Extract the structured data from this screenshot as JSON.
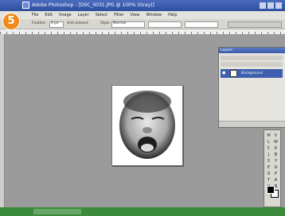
{
  "titlebar": {
    "title": "Adobe Photoshop - [DSC_0031.JPG @ 100% (Gray)]"
  },
  "badge": {
    "number": "5"
  },
  "menubar": {
    "items": [
      "File",
      "Edit",
      "Image",
      "Layer",
      "Select",
      "Filter",
      "View",
      "Window",
      "Help"
    ]
  },
  "optionsbar": {
    "feather_label": "Feather:",
    "feather_value": "0 px",
    "antialias_label": "Anti-aliased",
    "style_label": "Style:",
    "style_value": "Normal"
  },
  "layers_panel": {
    "tab_label": "Layers",
    "layer_name": "Background"
  },
  "toolbox": {
    "tools": [
      "M",
      "V",
      "L",
      "W",
      "C",
      "K",
      "J",
      "B",
      "S",
      "Y",
      "E",
      "G",
      "O",
      "P",
      "T",
      "A",
      "U",
      "N",
      "H",
      "Z"
    ]
  },
  "colors": {
    "badge": "#f08a1c",
    "titlebar": "#3b5aa8",
    "workspace": "#9b9b9b",
    "statusbar": "#3c8a3c"
  }
}
